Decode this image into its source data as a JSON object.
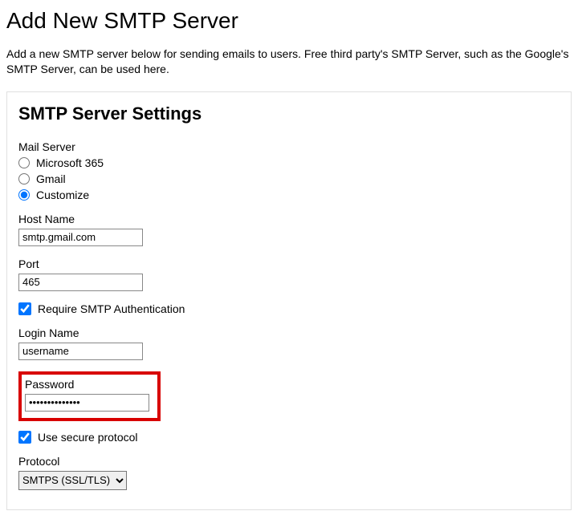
{
  "page": {
    "title": "Add New SMTP Server",
    "intro": "Add a new SMTP server below for sending emails to users. Free third party's SMTP Server, such as the Google's SMTP Server, can be used here."
  },
  "panel": {
    "title": "SMTP Server Settings"
  },
  "mailServer": {
    "label": "Mail Server",
    "options": {
      "ms365": "Microsoft 365",
      "gmail": "Gmail",
      "customize": "Customize"
    },
    "selected": "customize"
  },
  "hostName": {
    "label": "Host Name",
    "value": "smtp.gmail.com"
  },
  "port": {
    "label": "Port",
    "value": "465"
  },
  "requireAuth": {
    "label": "Require SMTP Authentication",
    "checked": true
  },
  "loginName": {
    "label": "Login Name",
    "value": "username"
  },
  "password": {
    "label": "Password",
    "value": "••••••••••••••"
  },
  "secureProtocol": {
    "label": "Use secure protocol",
    "checked": true
  },
  "protocol": {
    "label": "Protocol",
    "value": "SMTPS (SSL/TLS)"
  }
}
